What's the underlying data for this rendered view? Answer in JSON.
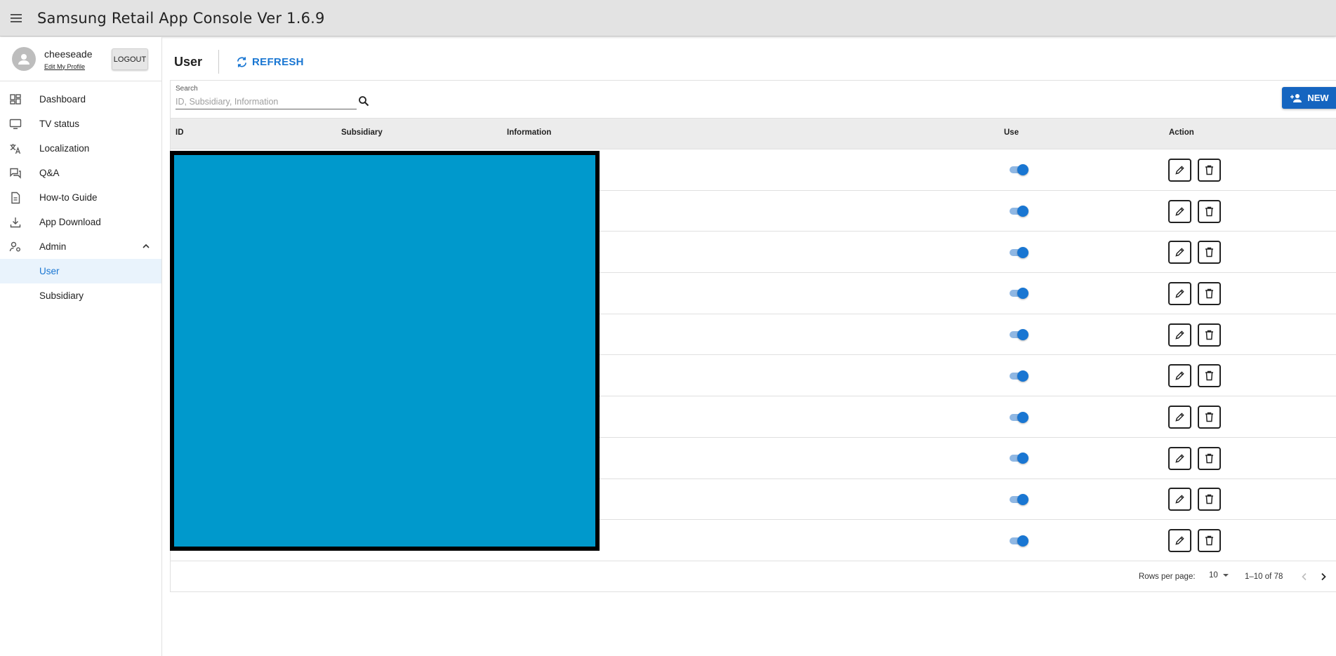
{
  "app": {
    "title": "Samsung Retail App Console Ver 1.6.9"
  },
  "profile": {
    "username": "cheeseade",
    "edit_link": "Edit My Profile",
    "logout_label": "LOGOUT"
  },
  "sidebar": {
    "items": [
      {
        "label": "Dashboard",
        "icon": "dashboard-icon"
      },
      {
        "label": "TV status",
        "icon": "monitor-icon"
      },
      {
        "label": "Localization",
        "icon": "translate-icon"
      },
      {
        "label": "Q&A",
        "icon": "forum-icon"
      },
      {
        "label": "How-to Guide",
        "icon": "document-icon"
      },
      {
        "label": "App Download",
        "icon": "download-icon"
      },
      {
        "label": "Admin",
        "icon": "manage-accounts-icon",
        "expanded": true
      },
      {
        "label": "User",
        "active": true
      },
      {
        "label": "Subsidiary"
      }
    ]
  },
  "page": {
    "title": "User",
    "refresh_label": "REFRESH"
  },
  "search": {
    "label": "Search",
    "placeholder": "ID, Subsidiary, Information",
    "value": ""
  },
  "new_button": {
    "label": "NEW"
  },
  "table": {
    "columns": [
      "ID",
      "Subsidiary",
      "Information",
      "Use",
      "Action"
    ],
    "rows_visible": 10,
    "row_use_state": [
      true,
      true,
      true,
      true,
      true,
      true,
      true,
      true,
      true,
      true
    ]
  },
  "pagination": {
    "rows_per_page_label": "Rows per page:",
    "rows_per_page_value": "10",
    "range": "1–10 of 78"
  },
  "colors": {
    "accent": "#1976d2",
    "new_button": "#1565c0",
    "appbar": "#e3e3e3",
    "active_nav_bg": "#e9f3fc",
    "redaction": "#0099cc"
  }
}
